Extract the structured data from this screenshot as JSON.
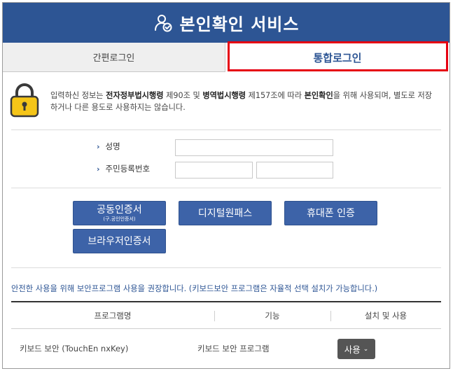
{
  "header": {
    "title": "본인확인 서비스",
    "icon": "user-check-icon"
  },
  "tabs": [
    {
      "label": "간편로그인",
      "active": false
    },
    {
      "label": "통합로그인",
      "active": true
    }
  ],
  "notice": {
    "icon": "lock-icon",
    "parts": {
      "p1": "입력하신 정보는 ",
      "law1": "전자정부법시행령",
      "p2": " 제90조 및 ",
      "law2": "병역법시행령",
      "p3": " 제157조에 따라 ",
      "purpose": "본인확인",
      "p4": "을 위해 사용되며, 별도로 저장하거나 다른 용도로 사용하지는 않습니다."
    }
  },
  "form": {
    "name_label": "성명",
    "rrn_label": "주민등록번호",
    "arrow": "›",
    "name_value": "",
    "rrn_front_value": "",
    "rrn_back_value": ""
  },
  "auth_buttons": {
    "joint_cert": {
      "label": "공동인증서",
      "sub": "(구.공인인증서)"
    },
    "digital_onepass": {
      "label": "디지털원패스"
    },
    "mobile": {
      "label": "휴대폰 인증"
    },
    "browser_cert": {
      "label": "브라우저인증서"
    }
  },
  "security": {
    "recommendation": "안전한 사용을 위해 보안프로그램 사용을 권장합니다. (키보드보안 프로그램은 자율적 선택 설치가 가능합니다.)",
    "columns": [
      "프로그램명",
      "기능",
      "설치 및 사용"
    ],
    "rows": [
      {
        "program": "키보드 보안 (TouchEn nxKey)",
        "function": "키보드 보안 프로그램",
        "action": "사용",
        "action_icon": "chevron-down-icon"
      }
    ]
  },
  "colors": {
    "header_bg": "#2d5594",
    "button_bg": "#3d63a8",
    "highlight": "#e60012",
    "lock": "#f5c518"
  }
}
